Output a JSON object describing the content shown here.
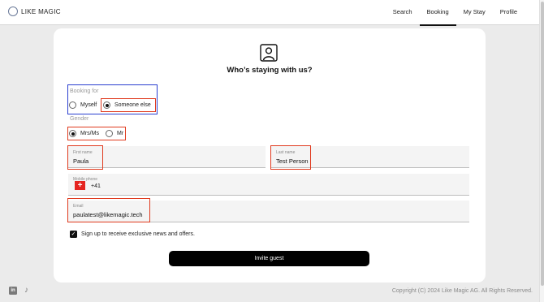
{
  "brand": {
    "name": "LIKE MAGIC"
  },
  "nav": {
    "items": [
      "Search",
      "Booking",
      "My Stay",
      "Profile"
    ],
    "active": "Booking"
  },
  "form": {
    "title": "Who’s staying with us?",
    "booking_for": {
      "label": "Booking for",
      "options": [
        "Myself",
        "Someone else"
      ],
      "selected": "Someone else"
    },
    "gender": {
      "label": "Gender",
      "options": [
        "Mrs/Ms",
        "Mr"
      ],
      "selected": "Mrs/Ms"
    },
    "first_name": {
      "label": "First name",
      "value": "Paula"
    },
    "last_name": {
      "label": "Last name",
      "value": "Test Person"
    },
    "mobile_phone": {
      "label": "Mobile phone",
      "country_code": "+41",
      "flag_icon": "switzerland-flag-icon"
    },
    "email": {
      "label": "Email",
      "value": "paulatest@likemagic.tech"
    },
    "newsletter": {
      "label": "Sign up to receive exclusive news and offers.",
      "checked": true
    },
    "submit_label": "Invite guest"
  },
  "footer": {
    "copyright": "Copyright (C) 2024 Like Magic AG. All Rights Reserved.",
    "social_icons": [
      "linkedin-icon",
      "tiktok-icon"
    ]
  },
  "colors": {
    "highlight_blue": "#2a3fd0",
    "highlight_red": "#e03a1e",
    "button_bg": "#000000",
    "swiss_red": "#e52420"
  }
}
